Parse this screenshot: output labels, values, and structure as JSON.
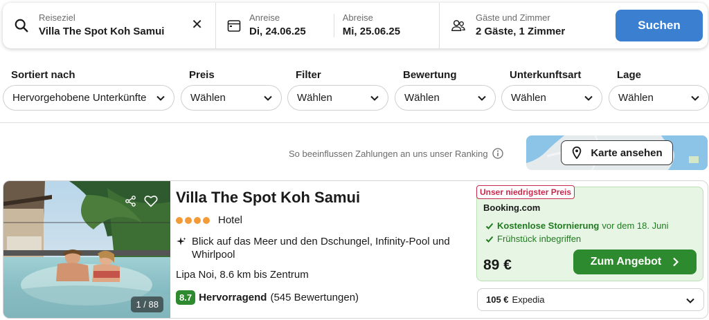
{
  "search": {
    "destination_label": "Reiseziel",
    "destination_value": "Villa The Spot Koh Samui",
    "checkin_label": "Anreise",
    "checkin_value": "Di, 24.06.25",
    "checkout_label": "Abreise",
    "checkout_value": "Mi, 25.06.25",
    "guests_label": "Gäste und Zimmer",
    "guests_value": "2 Gäste, 1 Zimmer",
    "search_button": "Suchen",
    "clear_glyph": "✕"
  },
  "filters": [
    {
      "label": "Sortiert nach",
      "value": "Hervorgehobene Unterkünfte"
    },
    {
      "label": "Preis",
      "value": "Wählen"
    },
    {
      "label": "Filter",
      "value": "Wählen"
    },
    {
      "label": "Bewertung",
      "value": "Wählen"
    },
    {
      "label": "Unterkunftsart",
      "value": "Wählen"
    },
    {
      "label": "Lage",
      "value": "Wählen"
    }
  ],
  "ranking_note": "So beeinflussen Zahlungen an uns unser Ranking",
  "map_button": "Karte ansehen",
  "listing": {
    "name": "Villa The Spot Koh Samui",
    "star_count": 4,
    "type": "Hotel",
    "feature": "Blick auf das Meer und den Dschungel, Infinity-Pool und Whirlpool",
    "location": "Lipa Noi, 8.6 km bis Zentrum",
    "photo_counter": "1 / 88",
    "score": "8.7",
    "rating_label": "Hervorragend",
    "review_count": "(545 Bewertungen)",
    "deal": {
      "badge": "Unser niedrigster Preis",
      "provider": "Booking.com",
      "perk1_bold": "Kostenlose Stornierung",
      "perk1_rest": "vor dem 18. Juni",
      "perk2": "Frühstück inbegriffen",
      "price": "89 €",
      "button": "Zum Angebot"
    },
    "alt_offer": {
      "price": "105 €",
      "provider": "Expedia"
    }
  },
  "colors": {
    "accent_blue": "#3a7fd0",
    "deal_green": "#2e8a2e",
    "badge_red": "#c8284c",
    "star_orange": "#f29b38"
  }
}
